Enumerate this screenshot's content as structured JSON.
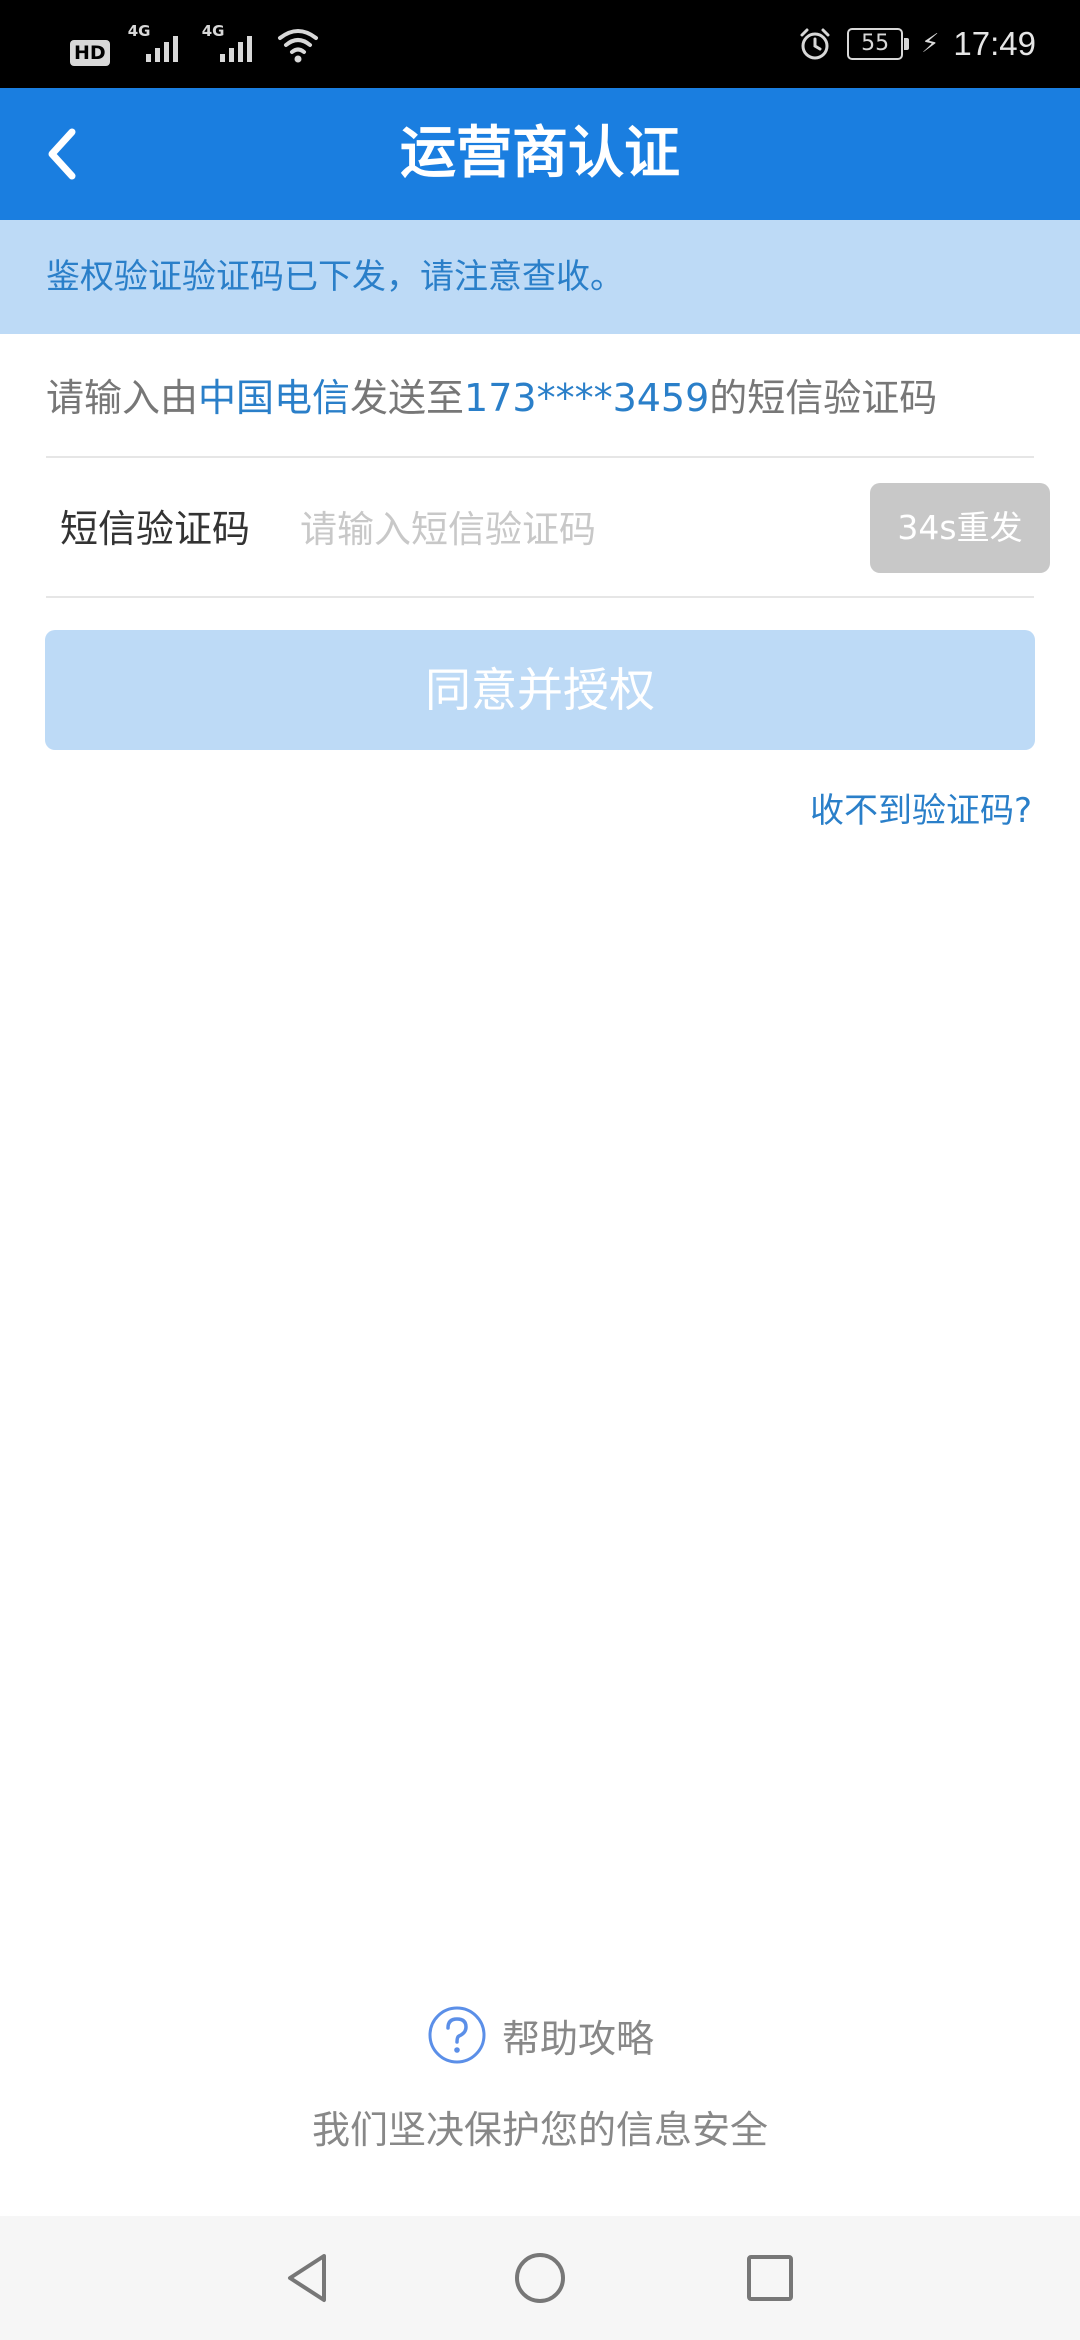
{
  "status_bar": {
    "hd": "HD",
    "network_1": "4G",
    "network_2": "4G",
    "battery_level": "55",
    "time": "17:49"
  },
  "header": {
    "title": "运营商认证",
    "back_icon": "chevron-left-icon"
  },
  "notice": {
    "text": "鉴权验证验证码已下发，请注意查收。"
  },
  "hint": {
    "prefix": "请输入由",
    "carrier": "中国电信",
    "middle": "发送至",
    "phone": "173****3459",
    "suffix": "的短信验证码"
  },
  "code_field": {
    "label": "短信验证码",
    "placeholder": "请输入短信验证码",
    "value": "",
    "resend_label": "34s重发"
  },
  "submit": {
    "label": "同意并授权"
  },
  "no_code_link": {
    "label": "收不到验证码?"
  },
  "footer": {
    "help_label": "帮助攻略",
    "help_icon": "question-circle-icon",
    "safety_text": "我们坚决保护您的信息安全"
  },
  "nav_bar": {
    "icons": [
      "back-triangle-icon",
      "home-circle-icon",
      "recents-square-icon"
    ]
  },
  "colors": {
    "app_bar": "#1a7ee0",
    "notice_bg": "#bddaf6",
    "accent_text": "#2a7fc9",
    "disabled_button": "#c8c8c8"
  }
}
